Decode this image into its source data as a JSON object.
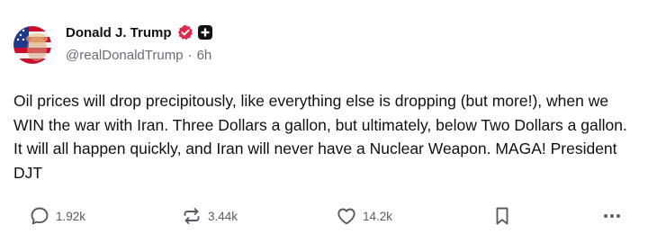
{
  "post": {
    "author": {
      "display_name": "Donald J. Trump",
      "handle": "@realDonaldTrump",
      "separator": "·",
      "time_ago": "6h",
      "verified_badge_color": "#e0294a",
      "plus_badge_color": "#111111"
    },
    "body": "Oil prices will drop precipitously, like everything else is dropping (but more!), when we WIN the war with Iran. Three Dollars a gallon, but ultimately, below Two Dollars a gallon. It will all happen quickly, and Iran will never have a Nuclear Weapon. MAGA! President DJT",
    "actions": {
      "replies": "1.92k",
      "retruths": "3.44k",
      "likes": "14.2k"
    },
    "icons": {
      "reply": "speech-bubble-icon",
      "retruth": "repost-arrows-icon",
      "like": "heart-icon",
      "save": "bookmark-icon",
      "more": "ellipsis-icon"
    },
    "colors": {
      "text": "#111111",
      "secondary": "#6b6b78",
      "action": "#5b5b66"
    }
  }
}
